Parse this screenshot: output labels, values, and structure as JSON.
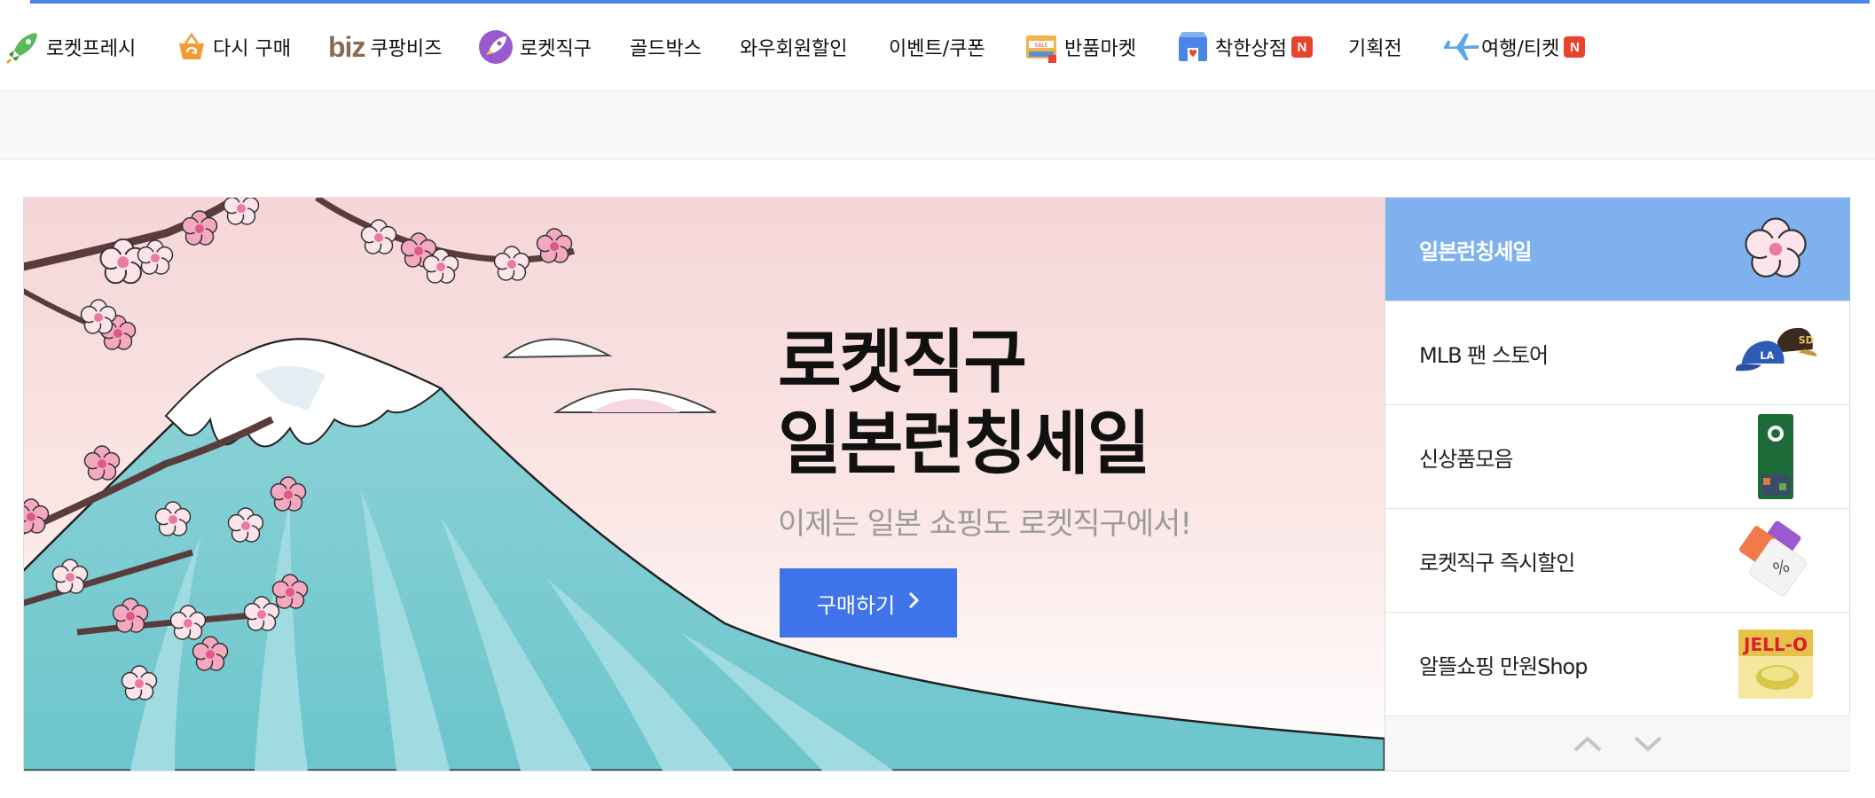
{
  "nav": {
    "items": [
      {
        "label": "로켓프레시",
        "icon": "rocket-fresh-icon"
      },
      {
        "label": "다시 구매",
        "icon": "rebuy-bag-icon"
      },
      {
        "label": "쿠팡비즈",
        "icon": "biz-logo",
        "logo_text": "biz"
      },
      {
        "label": "로켓직구",
        "icon": "rocket-global-icon"
      },
      {
        "label": "골드박스"
      },
      {
        "label": "와우회원할인"
      },
      {
        "label": "이벤트/쿠폰"
      },
      {
        "label": "반품마켓",
        "icon": "return-market-icon"
      },
      {
        "label": "착한상점",
        "icon": "good-store-icon",
        "badge": "N"
      },
      {
        "label": "기획전"
      },
      {
        "label": "여행/티켓",
        "icon": "airplane-icon",
        "badge": "N"
      }
    ]
  },
  "banner": {
    "title_line1": "로켓직구",
    "title_line2": "일본런칭세일",
    "subtitle": "이제는 일본 쇼핑도 로켓직구에서!",
    "button_label": "구매하기"
  },
  "side_list": {
    "items": [
      {
        "label": "일본런칭세일",
        "thumb": "cherry-blossom-icon",
        "active": true
      },
      {
        "label": "MLB 팬 스토어",
        "thumb": "baseball-caps-image"
      },
      {
        "label": "신상품모음",
        "thumb": "starbucks-coffee-bag-image"
      },
      {
        "label": "로켓직구 즉시할인",
        "thumb": "discount-coupon-image"
      },
      {
        "label": "알뜰쇼핑 만원Shop",
        "thumb": "jello-box-image"
      }
    ],
    "jello_text": "JELL-O"
  },
  "colors": {
    "accent": "#4a86e8",
    "button": "#3f73e9",
    "active_item": "#7eb1ee",
    "badge": "#e8432e"
  }
}
